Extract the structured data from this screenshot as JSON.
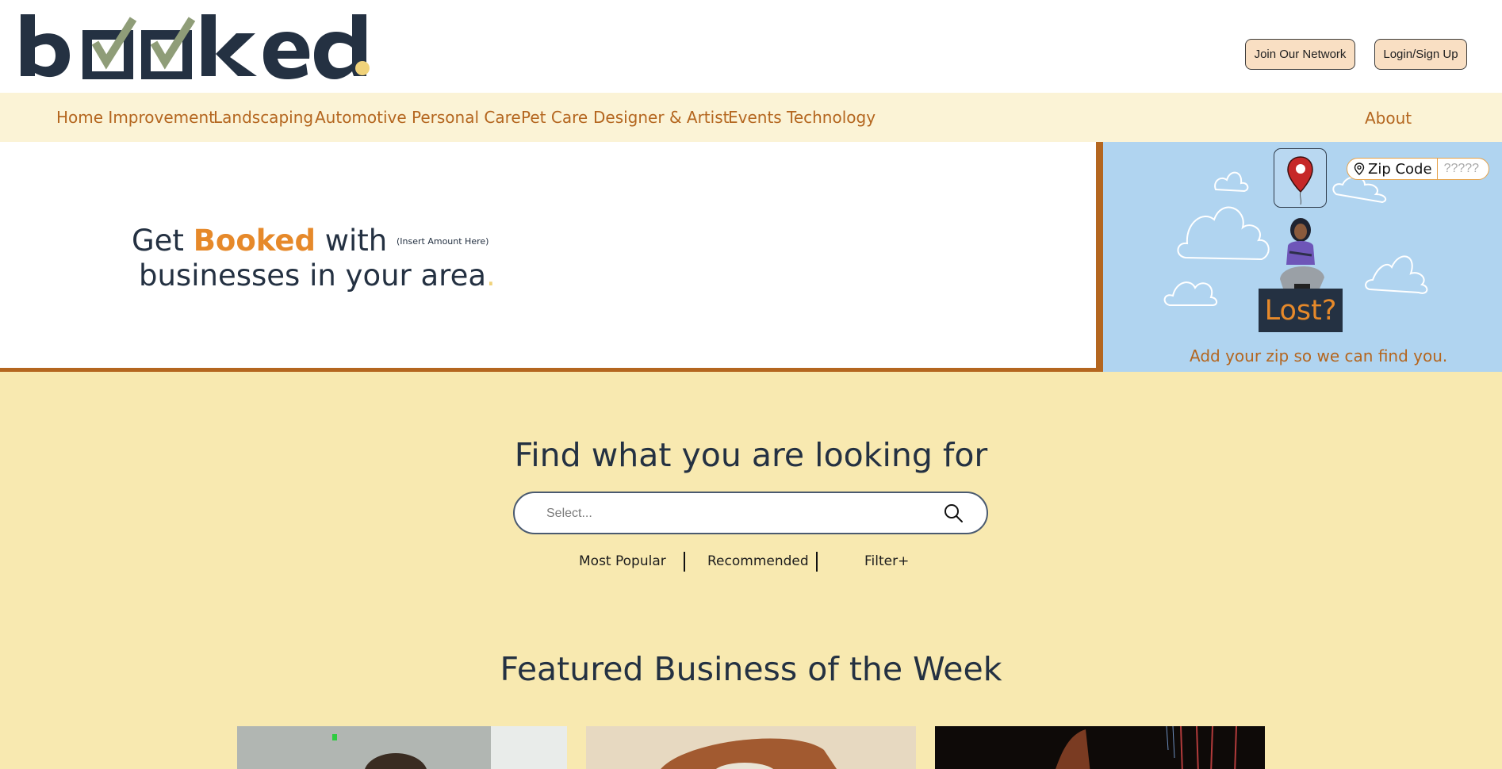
{
  "header": {
    "logo_text": "booked",
    "join_label": "Join Our Network",
    "login_label": "Login/Sign Up"
  },
  "nav": {
    "items": [
      {
        "label": "Home Improvement"
      },
      {
        "label": "Landscaping"
      },
      {
        "label": "Automotive"
      },
      {
        "label": "Personal Care"
      },
      {
        "label": "Pet Care"
      },
      {
        "label": "Designer & Artist"
      },
      {
        "label": "Events"
      },
      {
        "label": "Technology"
      }
    ],
    "about_label": "About"
  },
  "hero": {
    "get": "Get",
    "brand": "Booked",
    "with": "with",
    "amount": "(Insert Amount Here)",
    "line2": "businesses in your area",
    "period": "."
  },
  "zip": {
    "label": "Zip Code",
    "placeholder": "?????",
    "lost": "Lost?",
    "caption": "Add your zip so we can find you."
  },
  "search": {
    "title": "Find what you are looking for",
    "placeholder": "Select...",
    "filters": {
      "popular": "Most Popular",
      "recommended": "Recommended",
      "filter": "Filter+"
    }
  },
  "featured": {
    "title": "Featured Business of the Week"
  },
  "colors": {
    "navy": "#243142",
    "brown": "#b4661f",
    "orange": "#e6892a",
    "cream": "#f8e9b0",
    "sky": "#b0d4f0",
    "check_green": "#8f9d78",
    "logo_dot": "#f0d27a"
  }
}
